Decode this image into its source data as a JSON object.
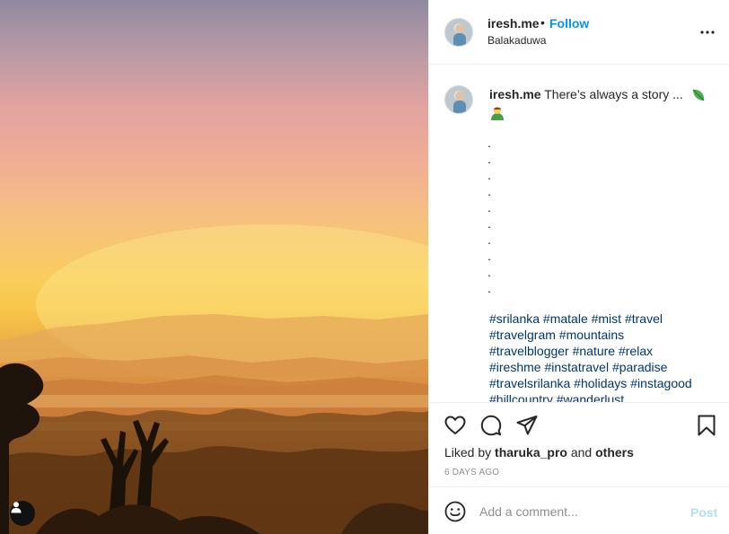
{
  "post": {
    "username": "iresh.me",
    "separator": "•",
    "follow_label": "Follow",
    "location": "Balakaduwa",
    "caption_username": "iresh.me",
    "caption_text": "There’s always a story ...",
    "caption_dots": [
      ".",
      ".",
      ".",
      ".",
      ".",
      ".",
      ".",
      ".",
      ".",
      "."
    ],
    "hashtag_lines": [
      "#srilanka #matale #mist #travel",
      "#travelgram #mountains",
      "#travelblogger #nature #relax",
      "#ireshme #instatravel #paradise",
      "#travelsrilanka #holidays #instagood",
      "#hillcountry #wanderlust"
    ],
    "liked_by_prefix": "Liked by",
    "liked_by_user": "tharuka_pro",
    "liked_by_and": "and",
    "liked_by_others": "others",
    "date": "6 DAYS AGO"
  },
  "comment_box": {
    "placeholder": "Add a comment...",
    "post_label": "Post"
  },
  "colors": {
    "link_blue": "#0095f6",
    "hashtag_blue": "#00376b",
    "post_disabled": "#b2dffc"
  },
  "icons": {
    "more": "more-horizontal-icon",
    "like": "heart-icon",
    "comment": "comment-icon",
    "share": "share-icon",
    "save": "bookmark-icon",
    "emoji": "smiley-icon",
    "user_tag": "user-tag-icon"
  }
}
